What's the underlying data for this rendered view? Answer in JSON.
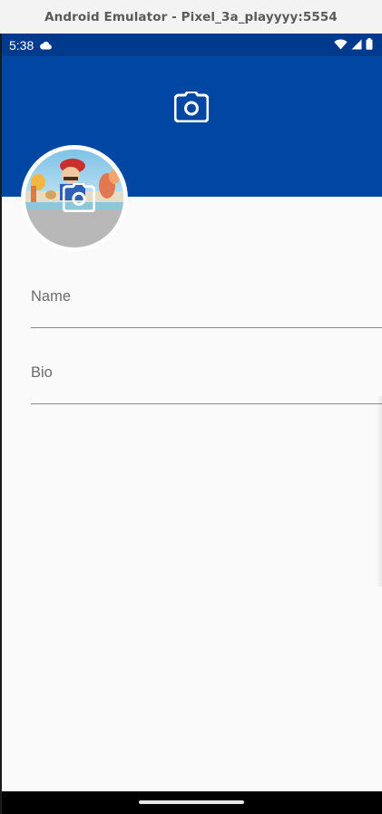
{
  "window": {
    "title": "Android Emulator - Pixel_3a_playyyy:5554"
  },
  "status_bar": {
    "time": "5:38",
    "icons": [
      "cloud-icon",
      "wifi-icon",
      "cellular-signal-icon",
      "battery-icon"
    ],
    "background_color": "#003a8c"
  },
  "header": {
    "background_color": "#0047a4",
    "camera_icon": "camera-icon"
  },
  "avatar": {
    "overlay_icon": "camera-icon"
  },
  "form": {
    "name_label": "Name",
    "bio_label": "Bio"
  }
}
